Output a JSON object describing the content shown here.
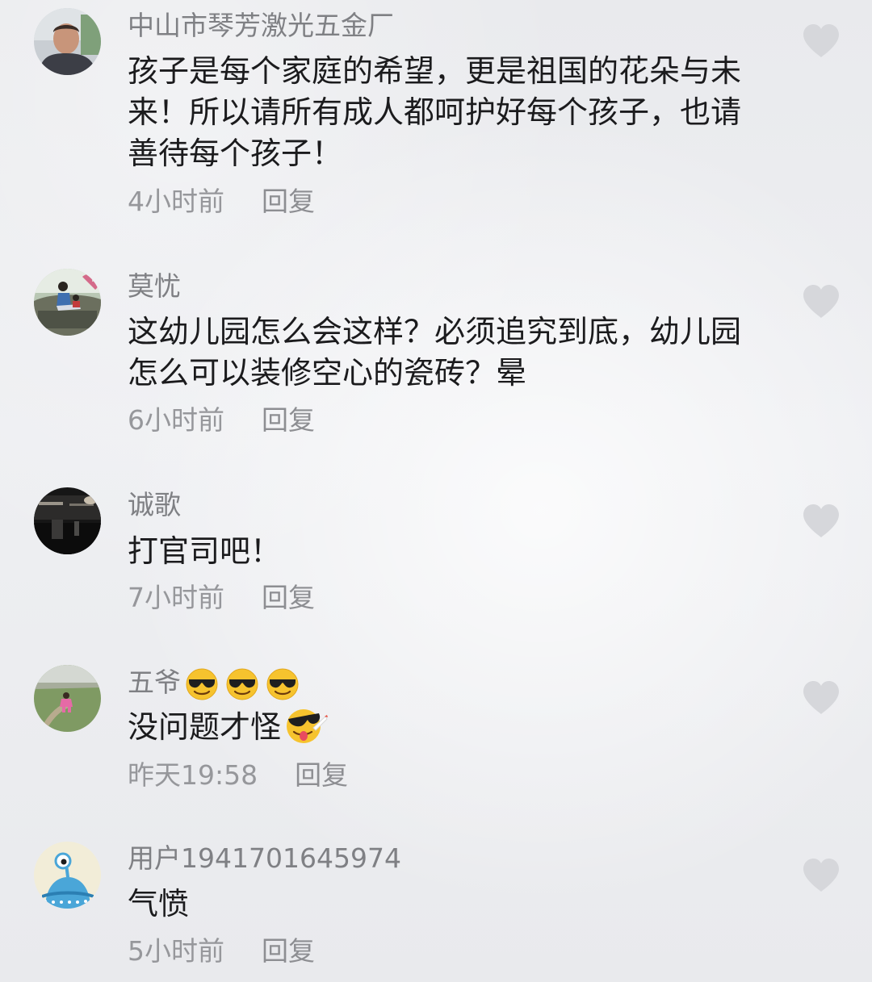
{
  "comments": [
    {
      "username": "中山市琴芳激光五金厂",
      "avatar_icon": "person-avatar-icon",
      "text": "孩子是每个家庭的希望，更是祖国的花朵与未来！所以请所有成人都呵护好每个孩子，也请善待每个孩子！",
      "time": "4小时前",
      "reply_label": "回复"
    },
    {
      "username": "莫忧",
      "avatar_icon": "photo-avatar-icon",
      "text": "这幼儿园怎么会这样？必须追究到底，幼儿园怎么可以装修空心的瓷砖？晕",
      "time": "6小时前",
      "reply_label": "回复"
    },
    {
      "username": "诚歌",
      "avatar_icon": "night-scene-avatar-icon",
      "text": "打官司吧！",
      "time": "7小时前",
      "reply_label": "回复"
    },
    {
      "username": "五爷",
      "username_emojis": [
        "sunglasses-emoji",
        "sunglasses-emoji",
        "sunglasses-emoji"
      ],
      "avatar_icon": "child-on-grass-avatar-icon",
      "text": "没问题才怪",
      "text_emoji": "sunglasses-tongue-emoji",
      "time": "昨天19:58",
      "reply_label": "回复"
    },
    {
      "username": "用户1941701645974",
      "avatar_icon": "blue-alien-avatar-icon",
      "text": "气愤",
      "time": "5小时前",
      "reply_label": "回复"
    }
  ],
  "like_icon": "heart-icon",
  "colors": {
    "background": "#ecedf0",
    "username": "#7f8084",
    "text": "#1b1b1d",
    "meta": "#96979b",
    "heart": "#d7d8dc"
  }
}
